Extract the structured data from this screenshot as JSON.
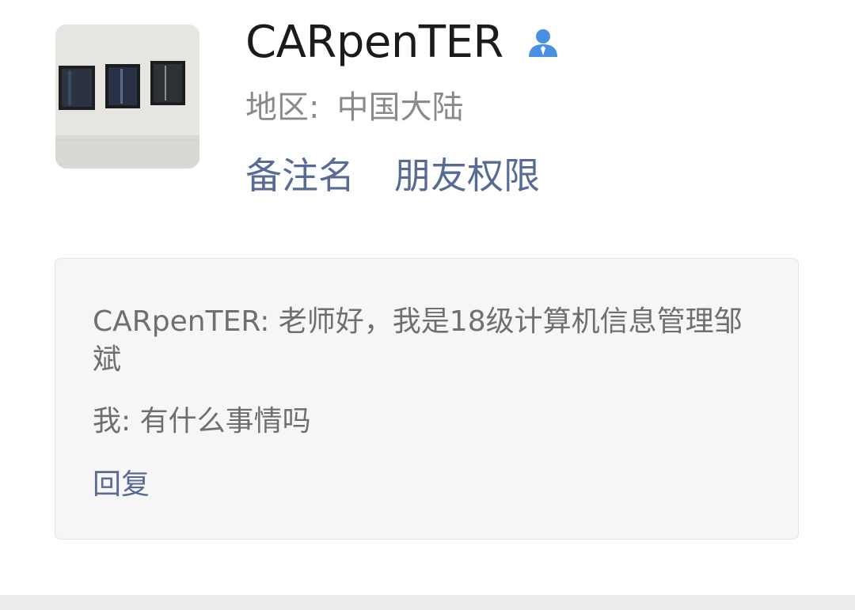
{
  "profile": {
    "name": "CARpenTER",
    "region_label": "地区:",
    "region_value": "中国大陆",
    "remark_link": "备注名",
    "permission_link": "朋友权限",
    "verify_icon": "person-icon"
  },
  "message_card": {
    "message_1": "CARpenTER: 老师好，我是18级计算机信息管理邹斌",
    "message_2": "我: 有什么事情吗",
    "reply_label": "回复"
  },
  "colors": {
    "link": "#576b95",
    "name": "#1b1b1b",
    "secondary_text": "#8a8a8a",
    "card_background": "#f6f6f7",
    "person_icon": "#4a90e2"
  }
}
